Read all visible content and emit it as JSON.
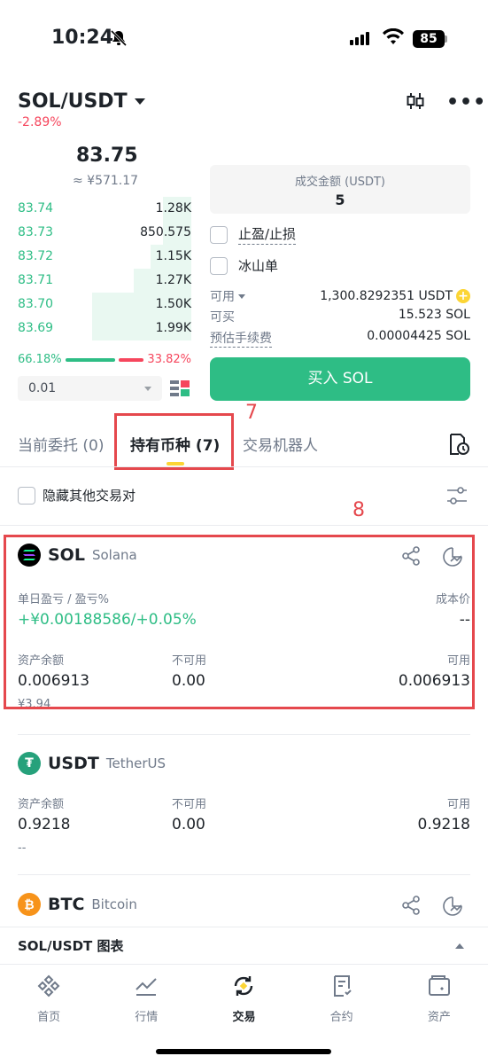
{
  "status": {
    "time": "10:24",
    "battery": "85"
  },
  "header": {
    "pair": "SOL/USDT",
    "change": "-2.89%"
  },
  "orderbook": {
    "price": "83.75",
    "cny": "≈ ¥571.17",
    "bids": [
      {
        "price": "83.74",
        "qty": "1.28K",
        "depth": 0.29
      },
      {
        "price": "83.73",
        "qty": "850.575",
        "depth": 0.29
      },
      {
        "price": "83.72",
        "qty": "1.15K",
        "depth": 0.41
      },
      {
        "price": "83.71",
        "qty": "1.27K",
        "depth": 0.58
      },
      {
        "price": "83.70",
        "qty": "1.50K",
        "depth": 1.0
      },
      {
        "price": "83.69",
        "qty": "1.99K",
        "depth": 1.0
      }
    ],
    "buy_ratio": "66.18%",
    "sell_ratio": "33.82%",
    "buy_fraction": 0.6618,
    "precision": "0.01"
  },
  "form": {
    "amount_label": "成交金额 (USDT)",
    "amount_value": "5",
    "tp_sl": "止盈/止损",
    "iceberg": "冰山单",
    "available_label": "可用",
    "available_value": "1,300.8292351 USDT",
    "can_buy_label": "可买",
    "can_buy_value": "15.523 SOL",
    "fee_label": "预估手续费",
    "fee_value": "0.00004425 SOL",
    "buy_button": "买入 SOL"
  },
  "tabs": {
    "open_orders": "当前委托 (0)",
    "holdings": "持有币种 (7)",
    "bots": "交易机器人",
    "annotation_7": "7",
    "annotation_8": "8"
  },
  "hide_others": "隐藏其他交易对",
  "assets": [
    {
      "symbol": "SOL",
      "name": "Solana",
      "pnl_label": "单日盈亏 / 盈亏%",
      "pnl_value": "+¥0.00188586/+0.05%",
      "cost_label": "成本价",
      "cost_value": "--",
      "balance_label": "资产余额",
      "balance": "0.006913",
      "unavailable_label": "不可用",
      "unavailable": "0.00",
      "available_label": "可用",
      "available": "0.006913",
      "cny": "¥3.94"
    },
    {
      "symbol": "USDT",
      "name": "TetherUS",
      "balance_label": "资产余额",
      "balance": "0.9218",
      "unavailable_label": "不可用",
      "unavailable": "0.00",
      "available_label": "可用",
      "available": "0.9218",
      "cny": "--"
    },
    {
      "symbol": "BTC",
      "name": "Bitcoin"
    }
  ],
  "chart_bar": "SOL/USDT 图表",
  "nav": [
    {
      "label": "首页",
      "icon": "home-icon"
    },
    {
      "label": "行情",
      "icon": "markets-icon"
    },
    {
      "label": "交易",
      "icon": "trade-icon"
    },
    {
      "label": "合约",
      "icon": "futures-icon"
    },
    {
      "label": "资产",
      "icon": "wallet-icon"
    }
  ],
  "colors": {
    "green": "#2ebd85",
    "red": "#f6465d",
    "yellow": "#fcd535",
    "annotation": "#e5484d"
  }
}
